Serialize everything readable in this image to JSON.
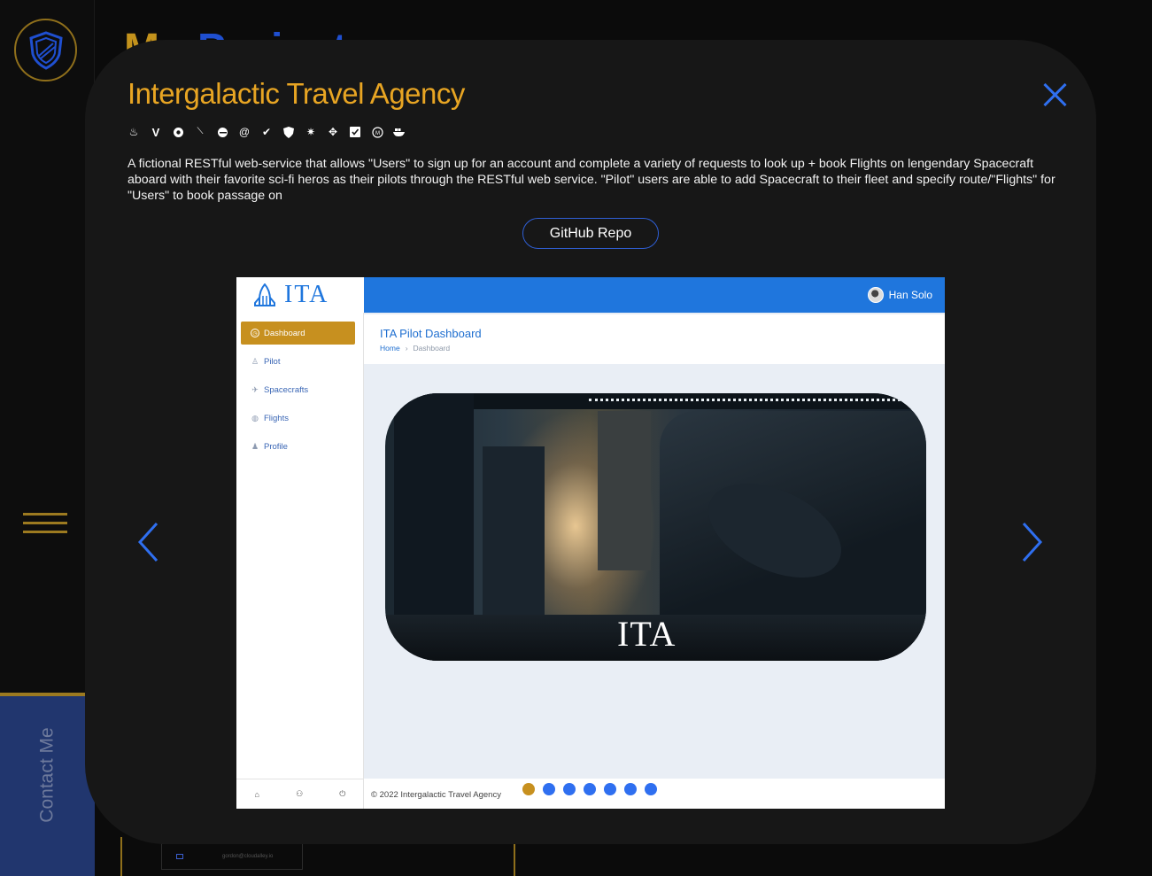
{
  "background": {
    "heading_part1": "My",
    "heading_part2": "Projects",
    "contact_label": "Contact Me",
    "email": "gordon@cloudalley.io"
  },
  "modal": {
    "title": "Intergalactic Travel Agency",
    "tech_icons": [
      "java-icon",
      "vue-icon",
      "postgres-icon",
      "jwt-icon",
      "eclipse-icon",
      "at-icon",
      "check-icon",
      "shield-icon",
      "gear-icon",
      "network-icon",
      "checkbox-icon",
      "maven-icon",
      "docker-icon"
    ],
    "description": "A fictional RESTful web-service that allows \"Users\" to sign up for an account and complete a variety of requests to look up + book Flights on lengendary Spacecraft aboard with their favorite sci-fi heros as their pilots through the RESTful web service. \"Pilot\" users are able to add Spacecraft to their fleet and specify route/\"Flights\" for \"Users\" to book passage on",
    "github_label": "GitHub Repo",
    "carousel": {
      "active_index": 0,
      "total": 7
    }
  },
  "screenshot": {
    "brand": "ITA",
    "user": "Han Solo",
    "nav": [
      {
        "label": "Dashboard",
        "icon": "dashboard-icon",
        "active": true
      },
      {
        "label": "Pilot",
        "icon": "pilot-icon",
        "active": false
      },
      {
        "label": "Spacecrafts",
        "icon": "plane-icon",
        "active": false
      },
      {
        "label": "Flights",
        "icon": "globe-icon",
        "active": false
      },
      {
        "label": "Profile",
        "icon": "profile-icon",
        "active": false
      }
    ],
    "page_title": "ITA Pilot Dashboard",
    "breadcrumb_home": "Home",
    "breadcrumb_current": "Dashboard",
    "hero_text": "ITA",
    "footer": "© 2022 Intergalactic Travel Agency"
  },
  "colors": {
    "accent_gold": "#e8a523",
    "accent_blue": "#2f6ff0",
    "modal_bg": "#171717"
  }
}
